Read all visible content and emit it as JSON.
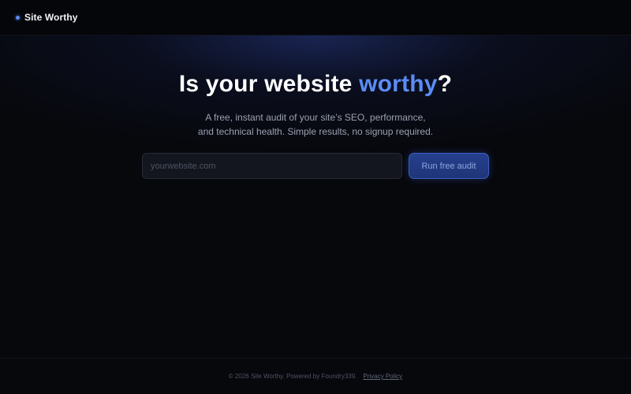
{
  "header": {
    "brand_name": "Site Worthy",
    "brand_dot_color": "#5b8cf5"
  },
  "hero": {
    "title_prefix": "Is your website ",
    "title_accent": "worthy",
    "title_suffix": "?",
    "accent_color": "#5b8cf5",
    "subtitle_line1": "A free, instant audit of your site’s SEO, performance,",
    "subtitle_line2": "and technical health. Simple results, no signup required."
  },
  "audit_form": {
    "input_placeholder": "yourwebsite.com",
    "input_value": "",
    "submit_label": "Run free audit"
  },
  "footer": {
    "copyright": "© 2026 Site Worthy. Powered by Foundry339.",
    "privacy_link": "Privacy Policy"
  }
}
